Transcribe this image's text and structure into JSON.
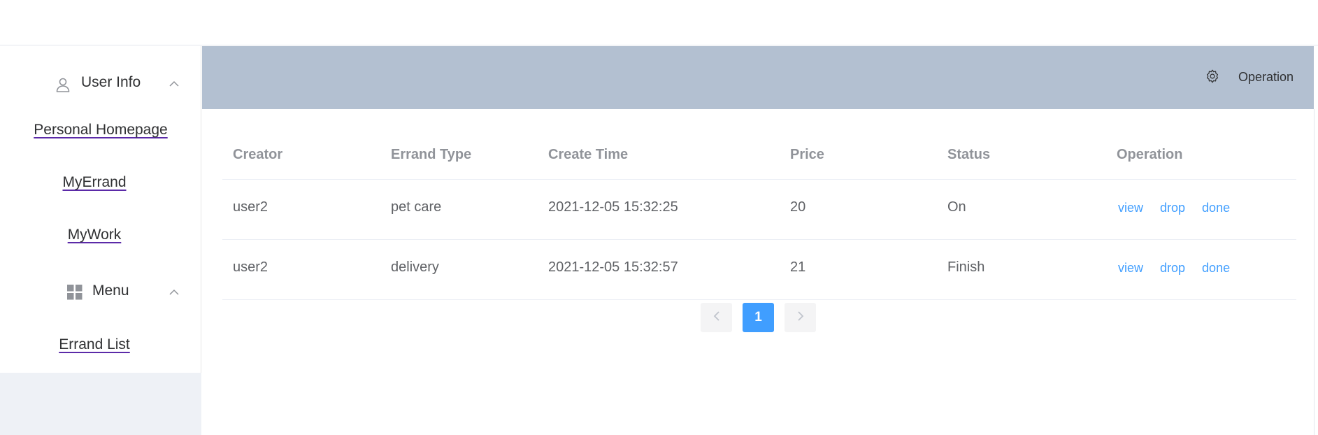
{
  "sidebar": {
    "user_info": {
      "label": "User Info",
      "icon": "user-icon"
    },
    "user_links": [
      "Personal Homepage",
      "MyErrand",
      "MyWork"
    ],
    "menu": {
      "label": "Menu",
      "icon": "grid-icon"
    },
    "menu_links": [
      "Errand List"
    ]
  },
  "header": {
    "operation_label": "Operation",
    "icon": "gear-icon",
    "bg_color": "#b3c0d1"
  },
  "table": {
    "columns": [
      "Creator",
      "Errand Type",
      "Create Time",
      "Price",
      "Status",
      "Operation"
    ],
    "rows": [
      {
        "creator": "user2",
        "errand_type": "pet care",
        "create_time": "2021-12-05 15:32:25",
        "price": "20",
        "status": "On",
        "ops": [
          "view",
          "drop",
          "done"
        ]
      },
      {
        "creator": "user2",
        "errand_type": "delivery",
        "create_time": "2021-12-05 15:32:57",
        "price": "21",
        "status": "Finish",
        "ops": [
          "view",
          "drop",
          "done"
        ]
      }
    ]
  },
  "pagination": {
    "current_page": "1",
    "prev_icon": "chevron-left-icon",
    "next_icon": "chevron-right-icon"
  },
  "colors": {
    "accent": "#409eff",
    "link_underline": "#5b2aa8"
  }
}
